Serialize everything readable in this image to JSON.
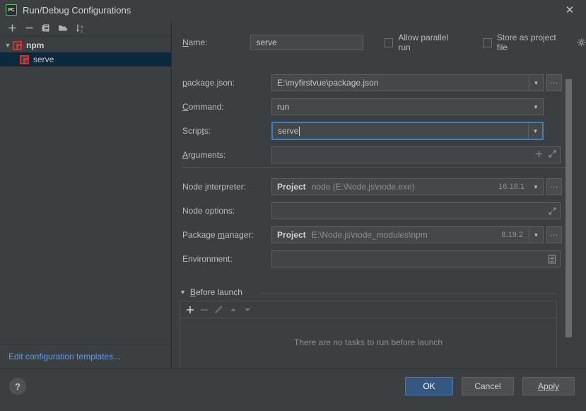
{
  "window": {
    "title": "Run/Debug Configurations",
    "app_icon": "pycharm-icon",
    "close_label": "✕"
  },
  "left_panel": {
    "toolbar": [
      {
        "name": "add-configuration-button",
        "icon": "plus-icon"
      },
      {
        "name": "remove-configuration-button",
        "icon": "minus-icon"
      },
      {
        "name": "copy-configuration-button",
        "icon": "copy-icon"
      },
      {
        "name": "new-folder-button",
        "icon": "folder-add-icon"
      },
      {
        "name": "sort-configurations-button",
        "icon": "sort-az-icon"
      }
    ],
    "tree": [
      {
        "label": "npm",
        "type": "group",
        "expanded": true,
        "icon": "npm-icon"
      },
      {
        "label": "serve",
        "type": "child",
        "selected": true,
        "icon": "npm-icon"
      }
    ],
    "edit_templates_link": "Edit configuration templates..."
  },
  "form": {
    "name_label": "Name:",
    "name_value": "serve",
    "allow_parallel_run_label": "Allow parallel run",
    "allow_parallel_run_checked": false,
    "store_as_project_file_label": "Store as project file",
    "store_as_project_file_checked": false,
    "fields": {
      "package_json": {
        "label": "package.json:",
        "value": "E:\\myfirstvue\\package.json",
        "browse_label": "..."
      },
      "command": {
        "label": "Command:",
        "value": "run"
      },
      "scripts": {
        "label": "Scripts:",
        "value": "serve",
        "focused": true
      },
      "arguments": {
        "label": "Arguments:",
        "value": ""
      },
      "node_interpreter": {
        "label": "Node interpreter:",
        "prefix": "Project",
        "value": "node (E:\\Node.js\\node.exe)",
        "version": "16.18.1",
        "browse_label": "..."
      },
      "node_options": {
        "label": "Node options:",
        "value": ""
      },
      "package_manager": {
        "label": "Package manager:",
        "prefix": "Project",
        "value": "E:\\Node.js\\node_modules\\npm",
        "version": "8.19.2",
        "browse_label": "..."
      },
      "environment": {
        "label": "Environment:",
        "value": ""
      }
    },
    "before_launch": {
      "title": "Before launch",
      "expanded": true,
      "empty_message": "There are no tasks to run before launch",
      "toolbar": [
        {
          "name": "add-task-button",
          "icon": "plus-icon",
          "enabled": true
        },
        {
          "name": "remove-task-button",
          "icon": "minus-icon",
          "enabled": false
        },
        {
          "name": "edit-task-button",
          "icon": "pencil-icon",
          "enabled": false
        },
        {
          "name": "move-task-up-button",
          "icon": "triangle-up-icon",
          "enabled": false
        },
        {
          "name": "move-task-down-button",
          "icon": "triangle-down-icon",
          "enabled": false
        }
      ]
    }
  },
  "footer": {
    "help_label": "?",
    "ok_label": "OK",
    "cancel_label": "Cancel",
    "apply_label": "Apply"
  },
  "colors": {
    "window_bg": "#3c3f41",
    "field_bg": "#45484a",
    "accent_blue": "#365880",
    "focus_blue": "#3d7fc1",
    "link_blue": "#589df6",
    "selection_bg": "#0d293e",
    "npm_red": "#cc3534"
  }
}
